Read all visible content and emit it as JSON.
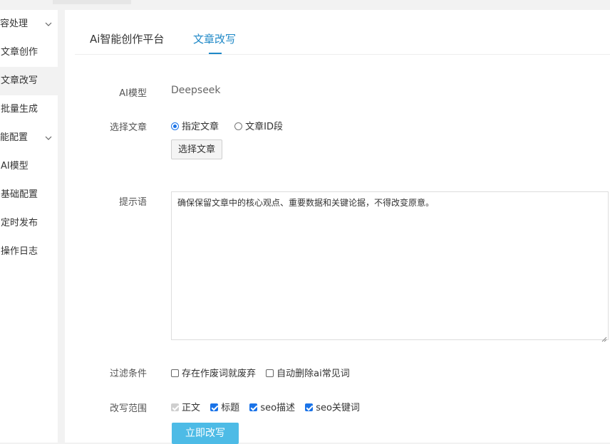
{
  "sidebar": {
    "items": [
      {
        "label": "内容处理",
        "type": "group"
      },
      {
        "label": "文章创作",
        "type": "sub"
      },
      {
        "label": "文章改写",
        "type": "sub",
        "active": true
      },
      {
        "label": "批量生成",
        "type": "sub"
      },
      {
        "label": "功能配置",
        "type": "group"
      },
      {
        "label": "AI模型",
        "type": "sub"
      },
      {
        "label": "基础配置",
        "type": "sub"
      },
      {
        "label": "定时发布",
        "type": "sub"
      },
      {
        "label": "操作日志",
        "type": "sub"
      }
    ],
    "chevron": "chevron-down-icon"
  },
  "header": {
    "brand": "Ai智能创作平台",
    "active_tab": "文章改写"
  },
  "form": {
    "model_label": "AI模型",
    "model_value": "Deepseek",
    "article_label": "选择文章",
    "radio_specified": "指定文章",
    "radio_id_range": "文章ID段",
    "select_article_button": "选择文章",
    "prompt_label": "提示语",
    "prompt_value": "确保保留文章中的核心观点、重要数据和关键论据，不得改变原意。",
    "filter_label": "过滤条件",
    "filter_discard": "存在作废词就废弃",
    "filter_auto_delete": "自动删除ai常见词",
    "scope_label": "改写范围",
    "scope_body": "正文",
    "scope_title": "标题",
    "scope_seo_desc": "seo描述",
    "scope_seo_keywords": "seo关键词",
    "submit_button": "立即改写"
  },
  "colors": {
    "accent": "#1e88c7",
    "primary_button": "#4dbbe6",
    "checkbox": "#1a73e8"
  }
}
